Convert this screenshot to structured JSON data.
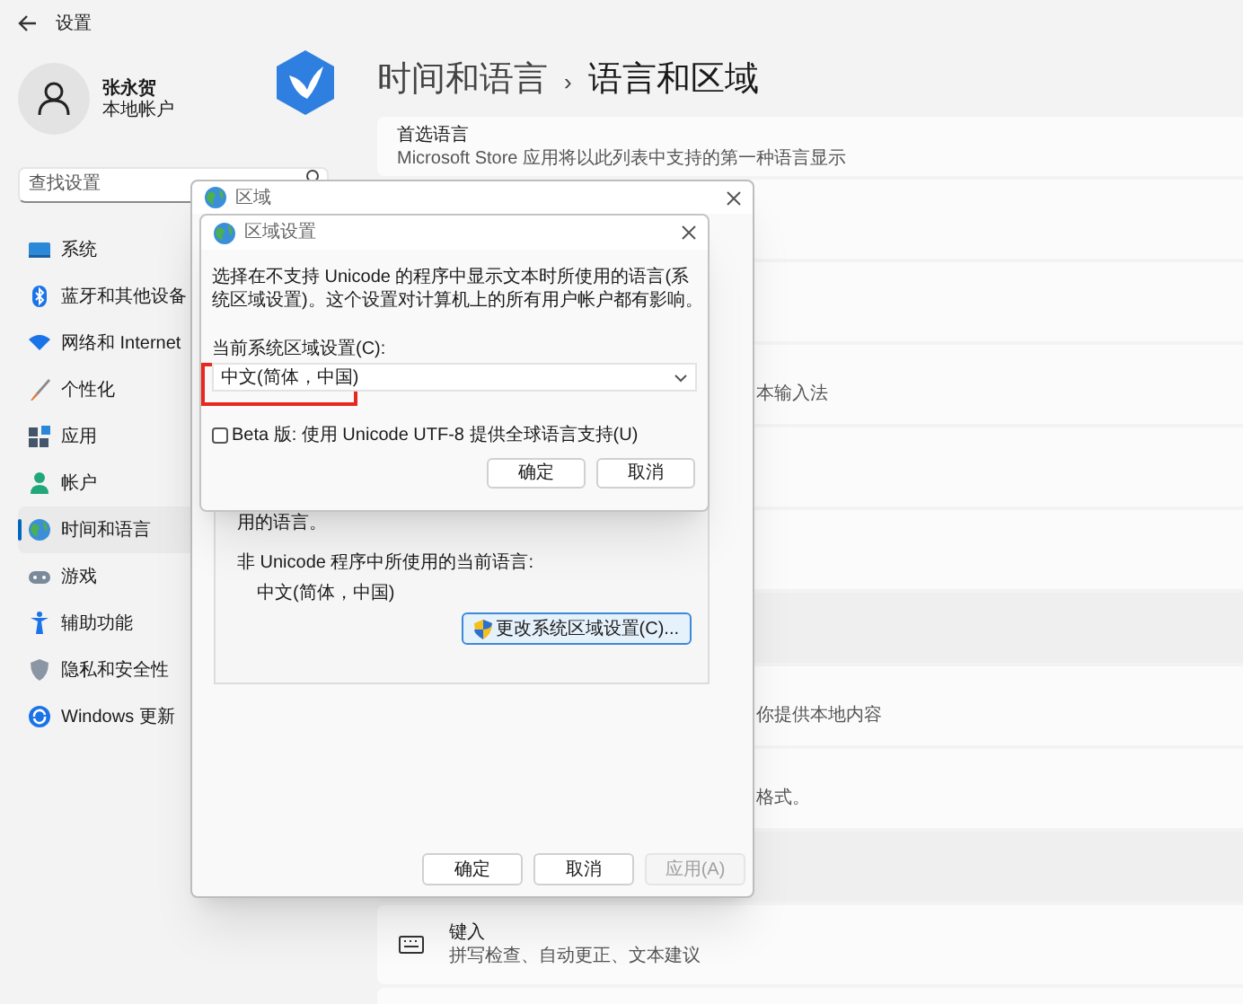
{
  "window": {
    "title": "设置"
  },
  "account": {
    "name": "张永贺",
    "type": "本地帐户"
  },
  "search": {
    "placeholder": "查找设置"
  },
  "nav": [
    {
      "label": "系统",
      "selected": false
    },
    {
      "label": "蓝牙和其他设备",
      "selected": false
    },
    {
      "label": "网络和 Internet",
      "selected": false
    },
    {
      "label": "个性化",
      "selected": false
    },
    {
      "label": "应用",
      "selected": false
    },
    {
      "label": "帐户",
      "selected": false
    },
    {
      "label": "时间和语言",
      "selected": true
    },
    {
      "label": "游戏",
      "selected": false
    },
    {
      "label": "辅助功能",
      "selected": false
    },
    {
      "label": "隐私和安全性",
      "selected": false
    },
    {
      "label": "Windows 更新",
      "selected": false
    }
  ],
  "breadcrumb": {
    "parent": "时间和语言",
    "separator": "›",
    "current": "语言和区域"
  },
  "cards": [
    {
      "kind": "card",
      "title": "首选语言",
      "subtitle": "Microsoft Store 应用将以此列表中支持的第一种语言显示"
    },
    {
      "kind": "card"
    },
    {
      "kind": "card"
    },
    {
      "kind": "card",
      "tail": "本输入法"
    },
    {
      "kind": "card"
    },
    {
      "kind": "card"
    },
    {
      "kind": "section"
    },
    {
      "kind": "card",
      "tail": "你提供本地内容"
    },
    {
      "kind": "card",
      "tail": "格式。"
    },
    {
      "kind": "section"
    },
    {
      "kind": "icon_card",
      "title": "键入",
      "subtitle": "拼写检查、自动更正、文本建议"
    },
    {
      "kind": "card"
    }
  ],
  "region_dialog": {
    "title": "区域",
    "group_text": "用的语言。",
    "current_label": "非 Unicode 程序中所使用的当前语言:",
    "current_value": "中文(简体，中国)",
    "change_button": "更改系统区域设置(C)...",
    "buttons": [
      {
        "label": "确定",
        "disabled": false
      },
      {
        "label": "取消",
        "disabled": false
      },
      {
        "label": "应用(A)",
        "disabled": true
      }
    ]
  },
  "locale_dialog": {
    "title": "区域设置",
    "description": "选择在不支持 Unicode 的程序中显示文本时所使用的语言(系统区域设置)。这个设置对计算机上的所有用户帐户都有影响。",
    "field_label": "当前系统区域设置(C):",
    "value": "中文(简体，中国)",
    "highlighted": true,
    "beta_checkbox": {
      "label": "Beta 版: 使用 Unicode UTF-8 提供全球语言支持(U)",
      "checked": false
    },
    "buttons": [
      {
        "label": "确定"
      },
      {
        "label": "取消"
      }
    ]
  }
}
